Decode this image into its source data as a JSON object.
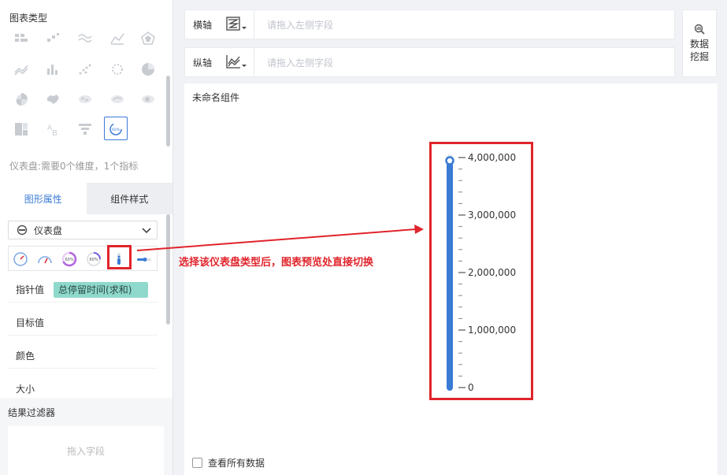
{
  "chart_types": {
    "title": "图表类型",
    "description": "仪表盘:需要0个维度，1个指标"
  },
  "prop_tabs": {
    "shape_props": "图形属性",
    "component_style": "组件样式"
  },
  "chart_select": {
    "value": "仪表盘"
  },
  "props": {
    "pointer_value_label": "指针值",
    "pointer_value_field": "总停留时间(求和)",
    "target_value_label": "目标值",
    "color_label": "颜色",
    "size_label": "大小"
  },
  "filter": {
    "title": "结果过滤器",
    "placeholder": "拖入字段"
  },
  "axes": {
    "x_label": "横轴",
    "x_placeholder": "请拖入左侧字段",
    "y_label": "纵轴",
    "y_placeholder": "请拖入左侧字段"
  },
  "data_mining": {
    "line1": "数据",
    "line2": "挖掘"
  },
  "preview": {
    "widget_name": "未命名组件",
    "view_all": "查看所有数据"
  },
  "annotation": {
    "text": "选择该仪表盘类型后，图表预览处直接切换"
  },
  "colors": {
    "accent": "#3a7bd5",
    "highlight": "#e0242b",
    "chip": "#8fd9cc"
  },
  "chart_data": {
    "type": "gauge",
    "orientation": "vertical",
    "ticks": [
      "4,000,000",
      "3,000,000",
      "2,000,000",
      "1,000,000",
      "0"
    ],
    "ylim": [
      0,
      4000000
    ],
    "value": 4000000
  }
}
